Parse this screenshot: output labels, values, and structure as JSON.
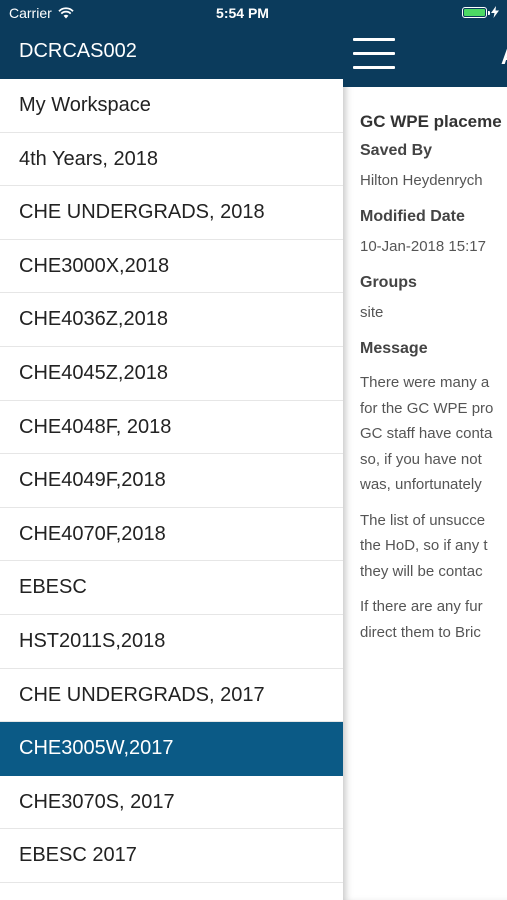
{
  "status_bar": {
    "carrier": "Carrier",
    "time": "5:54 PM"
  },
  "drawer": {
    "site_title": "DCRCAS002",
    "selected_color": "#0b5a86",
    "header_color": "#0b3b5c",
    "items": [
      {
        "label": "My Workspace"
      },
      {
        "label": "4th Years, 2018"
      },
      {
        "label": "CHE UNDERGRADS, 2018"
      },
      {
        "label": "CHE3000X,2018"
      },
      {
        "label": "CHE4036Z,2018"
      },
      {
        "label": "CHE4045Z,2018"
      },
      {
        "label": "CHE4048F, 2018"
      },
      {
        "label": "CHE4049F,2018"
      },
      {
        "label": "CHE4070F,2018"
      },
      {
        "label": "EBESC"
      },
      {
        "label": "HST2011S,2018"
      },
      {
        "label": "CHE UNDERGRADS, 2017"
      },
      {
        "label": "CHE3005W,2017",
        "selected": true
      },
      {
        "label": "CHE3070S, 2017"
      },
      {
        "label": "EBESC 2017"
      }
    ]
  },
  "main": {
    "header_title_partial": "A",
    "message": {
      "subject": "GC WPE placeme",
      "saved_by_label": "Saved By",
      "saved_by_value": "Hilton Heydenrych",
      "modified_label": "Modified Date",
      "modified_value": "10-Jan-2018 15:17",
      "groups_label": "Groups",
      "groups_value": "site",
      "message_label": "Message",
      "paragraphs": [
        [
          "There were many a",
          "for the GC WPE pro",
          "GC staff have conta",
          "so, if you have not",
          "was, unfortunately"
        ],
        [
          "The list of unsucce",
          "the HoD, so if any t",
          "they will be contac"
        ],
        [
          "If there are any fur",
          "direct them to Bric"
        ]
      ]
    }
  }
}
